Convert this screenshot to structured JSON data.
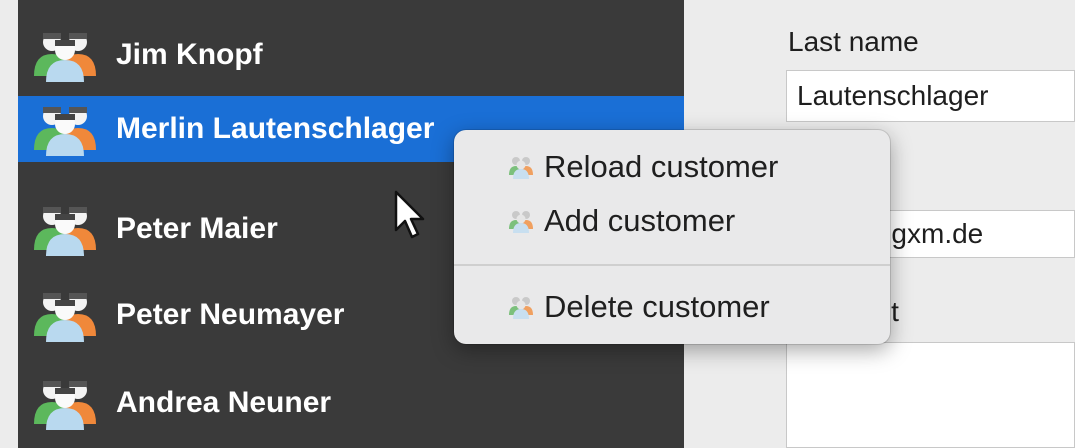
{
  "customers": [
    {
      "name": "Jim Knopf",
      "selected": false
    },
    {
      "name": "Merlin Lautenschlager",
      "selected": true
    },
    {
      "name": "Peter Maier",
      "selected": false
    },
    {
      "name": "Peter Neumayer",
      "selected": false
    },
    {
      "name": "Andrea Neuner",
      "selected": false
    }
  ],
  "form": {
    "last_name_label": "Last name",
    "last_name_value": "Lautenschlager",
    "email_value_visible": "@gxm.de",
    "comment_label_visible": "ent"
  },
  "context_menu": {
    "items": [
      {
        "label": "Reload customer",
        "icon": "customers-icon"
      },
      {
        "label": "Add customer",
        "icon": "customers-icon"
      },
      {
        "label": "Delete customer",
        "icon": "customers-icon"
      }
    ]
  },
  "colors": {
    "sidebar_bg": "#3a3a3a",
    "selection": "#1a6fd6",
    "menu_bg": "#e9e9ea"
  }
}
